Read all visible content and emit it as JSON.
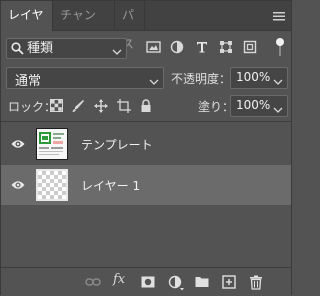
{
  "tabs": [
    {
      "label": "レイヤー",
      "active": true
    },
    {
      "label": "チャンネル",
      "active": false
    },
    {
      "label": "パス",
      "active": false
    }
  ],
  "filter": {
    "kind_value": "種類",
    "icons": [
      "pixel-layer-filter-icon",
      "adjustment-layer-filter-icon",
      "type-layer-filter-icon",
      "shape-layer-filter-icon",
      "smart-object-filter-icon"
    ]
  },
  "blend": {
    "mode": "通常",
    "opacity_label": "不透明度：",
    "opacity_value": "100%"
  },
  "lock": {
    "label": "ロック：",
    "fill_label": "塗り：",
    "fill_value": "100%"
  },
  "layers": [
    {
      "name": "テンプレート",
      "visible": true,
      "selected": false
    },
    {
      "name": "レイヤー 1",
      "visible": true,
      "selected": true
    }
  ],
  "bottom": {
    "fx_label": "fx"
  },
  "colors": {
    "panel_bg": "#535353",
    "tab_bg": "#424242",
    "selected_row": "#6b6b6b",
    "thumb_green": "#2e9a3c",
    "thumb_pink": "#f2a7a7"
  }
}
